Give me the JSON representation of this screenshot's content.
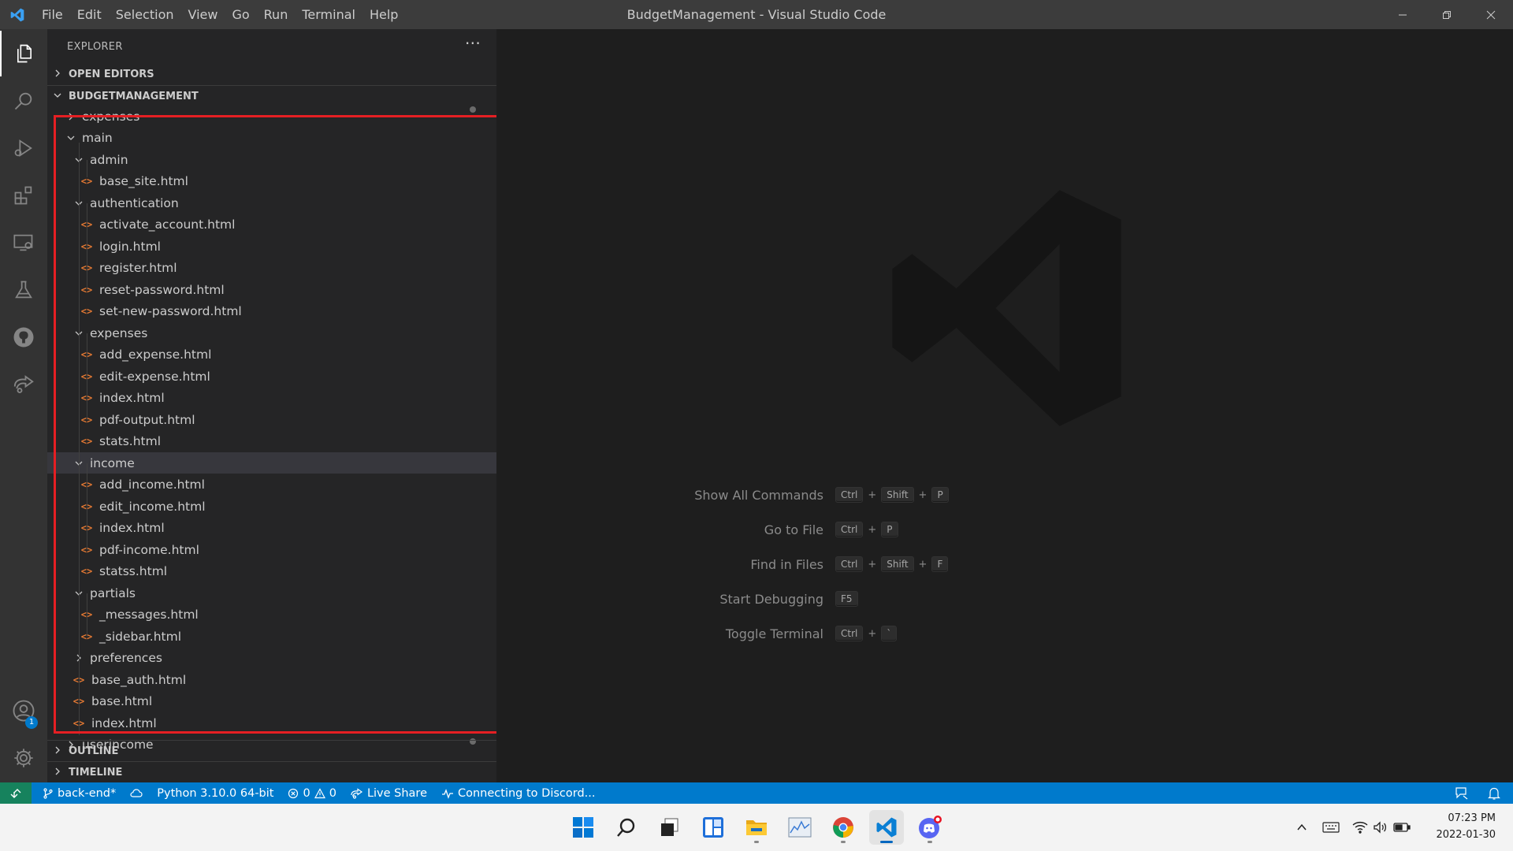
{
  "window": {
    "title": "BudgetManagement - Visual Studio Code",
    "menu": [
      "File",
      "Edit",
      "Selection",
      "View",
      "Go",
      "Run",
      "Terminal",
      "Help"
    ]
  },
  "activity_bar": {
    "items": [
      "explorer-icon",
      "search-icon",
      "run-debug-icon",
      "extensions-icon",
      "remote-explorer-icon",
      "testing-icon",
      "github-icon",
      "live-share-icon"
    ],
    "accounts_badge": "1"
  },
  "sidebar": {
    "title": "EXPLORER",
    "more": "···",
    "sections": {
      "open_editors": "OPEN EDITORS",
      "project": "BUDGETMANAGEMENT",
      "outline": "OUTLINE",
      "timeline": "TIMELINE"
    },
    "tree": [
      {
        "label": "expenses",
        "type": "folder",
        "expanded": false,
        "depth": 1,
        "partial": "top"
      },
      {
        "label": "main",
        "type": "folder",
        "expanded": true,
        "depth": 1
      },
      {
        "label": "admin",
        "type": "folder",
        "expanded": true,
        "depth": 2
      },
      {
        "label": "base_site.html",
        "type": "file",
        "depth": 3
      },
      {
        "label": "authentication",
        "type": "folder",
        "expanded": true,
        "depth": 2
      },
      {
        "label": "activate_account.html",
        "type": "file",
        "depth": 3
      },
      {
        "label": "login.html",
        "type": "file",
        "depth": 3
      },
      {
        "label": "register.html",
        "type": "file",
        "depth": 3
      },
      {
        "label": "reset-password.html",
        "type": "file",
        "depth": 3
      },
      {
        "label": "set-new-password.html",
        "type": "file",
        "depth": 3
      },
      {
        "label": "expenses",
        "type": "folder",
        "expanded": true,
        "depth": 2
      },
      {
        "label": "add_expense.html",
        "type": "file",
        "depth": 3
      },
      {
        "label": "edit-expense.html",
        "type": "file",
        "depth": 3
      },
      {
        "label": "index.html",
        "type": "file",
        "depth": 3
      },
      {
        "label": "pdf-output.html",
        "type": "file",
        "depth": 3
      },
      {
        "label": "stats.html",
        "type": "file",
        "depth": 3
      },
      {
        "label": "income",
        "type": "folder",
        "expanded": true,
        "depth": 2,
        "selected": true
      },
      {
        "label": "add_income.html",
        "type": "file",
        "depth": 3
      },
      {
        "label": "edit_income.html",
        "type": "file",
        "depth": 3
      },
      {
        "label": "index.html",
        "type": "file",
        "depth": 3
      },
      {
        "label": "pdf-income.html",
        "type": "file",
        "depth": 3
      },
      {
        "label": "statss.html",
        "type": "file",
        "depth": 3
      },
      {
        "label": "partials",
        "type": "folder",
        "expanded": true,
        "depth": 2
      },
      {
        "label": "_messages.html",
        "type": "file",
        "depth": 3
      },
      {
        "label": "_sidebar.html",
        "type": "file",
        "depth": 3
      },
      {
        "label": "preferences",
        "type": "folder",
        "expanded": false,
        "depth": 2
      },
      {
        "label": "base_auth.html",
        "type": "file",
        "depth": 2
      },
      {
        "label": "base.html",
        "type": "file",
        "depth": 2
      },
      {
        "label": "index.html",
        "type": "file",
        "depth": 2
      },
      {
        "label": "userincome",
        "type": "folder",
        "expanded": false,
        "depth": 1,
        "partial": "bottom"
      }
    ]
  },
  "editor": {
    "shortcuts": [
      {
        "label": "Show All Commands",
        "keys": [
          "Ctrl",
          "Shift",
          "P"
        ]
      },
      {
        "label": "Go to File",
        "keys": [
          "Ctrl",
          "P"
        ]
      },
      {
        "label": "Find in Files",
        "keys": [
          "Ctrl",
          "Shift",
          "F"
        ]
      },
      {
        "label": "Start Debugging",
        "keys": [
          "F5"
        ]
      },
      {
        "label": "Toggle Terminal",
        "keys": [
          "Ctrl",
          "`"
        ]
      }
    ]
  },
  "status_bar": {
    "branch": "back-end*",
    "python": "Python 3.10.0 64-bit",
    "errors": "0",
    "warnings": "0",
    "live_share": "Live Share",
    "discord": "Connecting to Discord..."
  },
  "taskbar": {
    "apps": [
      "windows-start-icon",
      "search-icon",
      "task-view-icon",
      "widgets-icon",
      "file-explorer-icon",
      "performance-monitor-icon",
      "chrome-icon",
      "vscode-icon",
      "discord-icon"
    ],
    "time": "07:23 PM",
    "date": "2022-01-30"
  },
  "colors": {
    "accent": "#007acc",
    "remote": "#16825d",
    "file_icon": "#e37933",
    "highlight_box": "#e51f23"
  }
}
